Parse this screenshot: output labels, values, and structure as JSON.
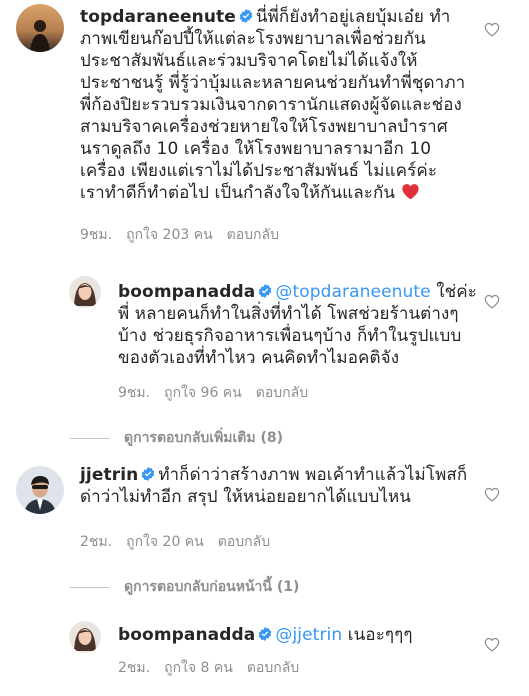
{
  "comments": [
    {
      "username": "topdaraneenute",
      "lines": [
        "นี่พี่ก็ยังทำอยู่เลยบุ้มเอ๋ย ทำ",
        "ภาพเขียนก๊อปปี้ให้แต่ละโรงพยาบาลเพื่อช่วยกัน",
        "ประชาสัมพันธ์และร่วมบริจาคโดยไม่ได้แจ้งให้",
        "ประชาชนรู้ พี่รู้ว่าบุ้มและหลายคนช่วยกันทำพี่ชุดาภา",
        "พี่ก้องปิยะรวบรวมเงินจากดารานักแสดงผู้จัดและช่อง",
        "สามบริจาคเครื่องช่วยหายใจให้โรงพยาบาลบำราศ",
        "นราดูลถึง 10 เครื่อง ให้โรงพยาบาลรามาอีก 10",
        "เครื่อง เพียงแต่เราไม่ได้ประชาสัมพันธ์ ไม่แคร์ค่ะ",
        "เราทำดีก็ทำต่อไป เป็นกำลังใจให้กันและกัน"
      ],
      "time": "9ชม.",
      "likes": "ถูกใจ 203 คน",
      "reply_label": "ตอบกลับ"
    },
    {
      "username": "boompanadda",
      "mention": "@topdaraneenute",
      "lines": [
        "ใช่ค่ะ",
        "พี่ หลายคนก็ทำในสิ่งที่ทำได้ โพสช่วยร้านต่างๆ",
        "บ้าง ช่วยธุรกิจอาหารเพื่อนๆบ้าง ก็ทำในรูปแบบ",
        "ของตัวเองที่ทำไหว คนคิดทำไมอคติจัง"
      ],
      "time": "9ชม.",
      "likes": "ถูกใจ 96 คน",
      "reply_label": "ตอบกลับ"
    },
    {
      "username": "jjetrin",
      "lines": [
        "ทำก็ด่าว่าสร้างภาพ พอเค้าทำแล้วไม่โพสก็",
        "ด่าว่าไม่ทำอีก สรุป ให้หน่อยอยากได้แบบไหน"
      ],
      "time": "2ชม.",
      "likes": "ถูกใจ 20 คน",
      "reply_label": "ตอบกลับ"
    },
    {
      "username": "boompanadda",
      "mention": "@jjetrin",
      "lines": [
        "เนอะๆๆๆ"
      ],
      "time": "2ชม.",
      "likes": "ถูกใจ 8 คน",
      "reply_label": "ตอบกลับ"
    }
  ],
  "view_more": "ดูการตอบกลับเพิ่มเติม (8)",
  "view_previous": "ดูการตอบกลับก่อนหน้านี้ (1)",
  "colors": {
    "link": "#3897f0",
    "meta": "#8e8e8e",
    "verified": "#3897f0",
    "heart_emoji": "#e0303a"
  }
}
